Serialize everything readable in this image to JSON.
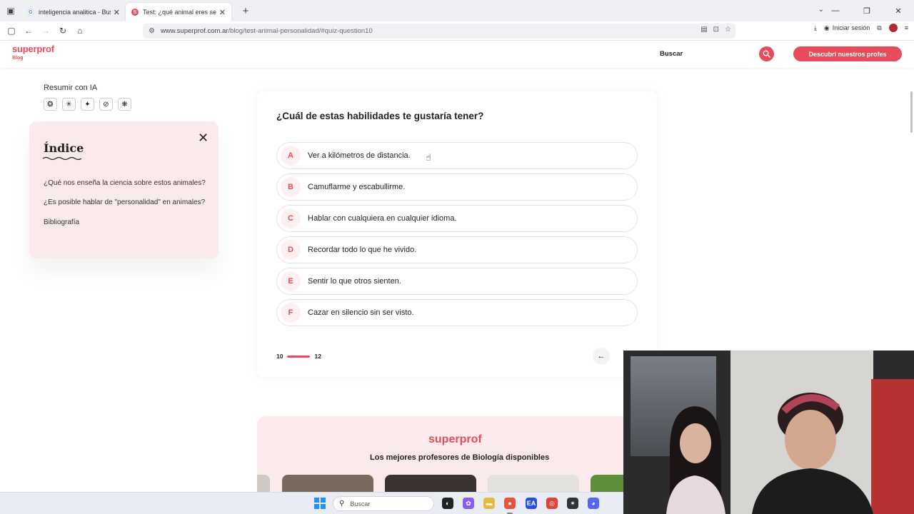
{
  "browser": {
    "tabs": [
      {
        "title": "inteligencia analitica - Buscar co",
        "favicon": "google-icon"
      },
      {
        "title": "Test: ¿qué animal eres según tu",
        "favicon": "superprof-icon"
      }
    ],
    "url_host": "www.superprof.com.ar",
    "url_path": "/blog/test-animal-personalidad/#quiz-question10",
    "signin_label": "Iniciar sesión"
  },
  "site": {
    "logo": "superprof",
    "logo_sub": "Blog",
    "search_label": "Buscar",
    "cta_label": "Descubrí nuestros profes",
    "accent": "#e84c5c"
  },
  "sidebar": {
    "summarize_label": "Resumir con IA",
    "ai_icons": [
      "chatgpt-icon",
      "claude-icon",
      "gemini-icon",
      "grok-icon",
      "perplexity-icon"
    ],
    "index_title": "Índice",
    "index_links": [
      "¿Qué nos enseña la ciencia sobre estos animales?",
      "¿Es posible hablar de \"personalidad\" en animales?",
      "Bibliografía"
    ]
  },
  "quiz": {
    "question": "¿Cuál de estas habilidades te gustaría tener?",
    "options": [
      {
        "letter": "A",
        "text": "Ver a kilómetros de distancia."
      },
      {
        "letter": "B",
        "text": "Camuflarme y escabullirme."
      },
      {
        "letter": "C",
        "text": "Hablar con cualquiera en cualquier idioma."
      },
      {
        "letter": "D",
        "text": "Recordar todo lo que he vivido."
      },
      {
        "letter": "E",
        "text": "Sentir lo que otros sienten."
      },
      {
        "letter": "F",
        "text": "Cazar en silencio sin ser visto."
      }
    ],
    "progress_current": "10",
    "progress_total": "12"
  },
  "teachers": {
    "brand": "superprof",
    "heading": "Los mejores profesores de Biología disponibles"
  },
  "taskbar": {
    "search_placeholder": "Buscar"
  }
}
